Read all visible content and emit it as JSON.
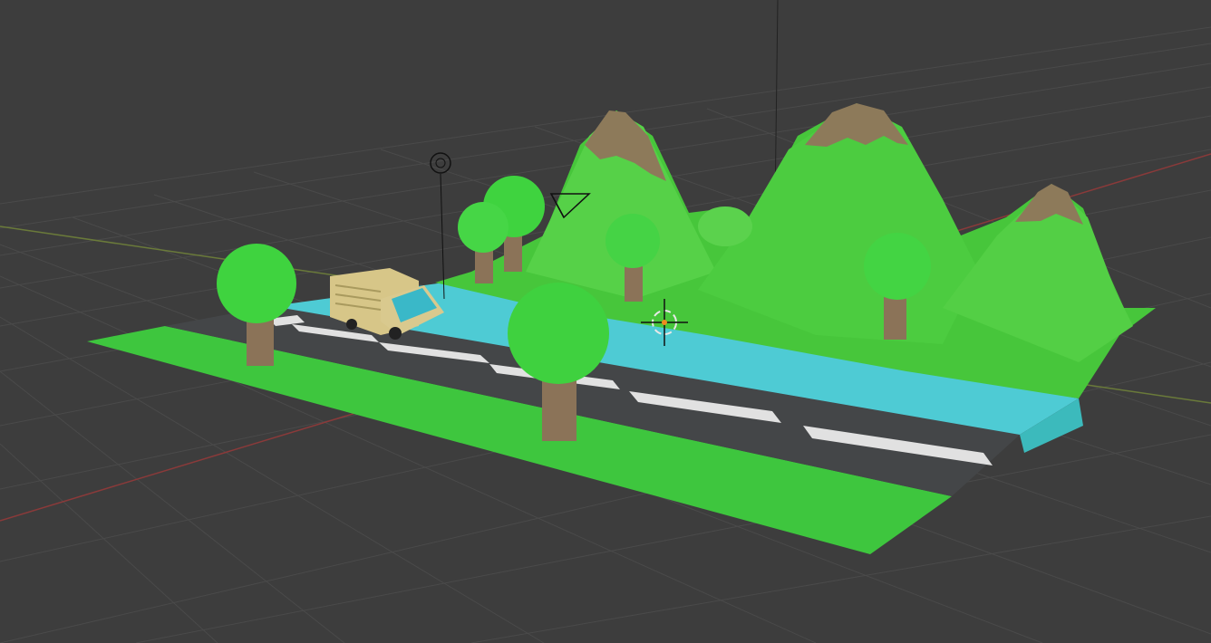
{
  "viewport": {
    "background": "#3d3d3d",
    "grid_color": "#4a4a4a",
    "axis_x_color": "#8a3a3a",
    "axis_y_color": "#6a8a3a"
  },
  "scene": {
    "objects": [
      {
        "kind": "road",
        "icon": "road-icon"
      },
      {
        "kind": "grass",
        "icon": "grass-icon"
      },
      {
        "kind": "river",
        "icon": "river-icon"
      },
      {
        "kind": "mountains",
        "icon": "mountain-icon"
      },
      {
        "kind": "trees",
        "count": 6,
        "icon": "tree-icon"
      },
      {
        "kind": "truck",
        "icon": "truck-icon"
      }
    ],
    "colors": {
      "grass": "#3dc43d",
      "grass_light": "#53d153",
      "road": "#434547",
      "road_stripe": "#e0e0e0",
      "river": "#4fcbd4",
      "mountain": "#46c63a",
      "mountain_light": "#5fd64e",
      "peak": "#8a7a5c",
      "tree_foliage": "#3ed43e",
      "tree_trunk": "#8b7358",
      "truck_body": "#d8c88a",
      "truck_window": "#3ab8c8"
    }
  },
  "overlays": {
    "light_icon": "light-icon",
    "camera_icon": "camera-icon",
    "cursor_icon": "3d-cursor-icon"
  }
}
